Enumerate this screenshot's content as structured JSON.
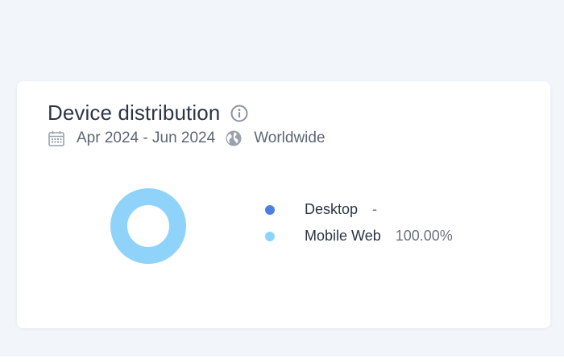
{
  "card": {
    "title": "Device distribution",
    "date_range": "Apr 2024 - Jun 2024",
    "region": "Worldwide",
    "icons": {
      "info": "info-icon",
      "calendar": "calendar-icon",
      "globe": "globe-icon"
    }
  },
  "chart_data": {
    "type": "pie",
    "style": "donut",
    "categories": [
      "Desktop",
      "Mobile Web"
    ],
    "values": [
      0,
      100
    ],
    "value_labels": [
      "-",
      "100.00%"
    ],
    "colors": [
      "#4e7ee3",
      "#8fd3fb"
    ],
    "legend": "right"
  }
}
